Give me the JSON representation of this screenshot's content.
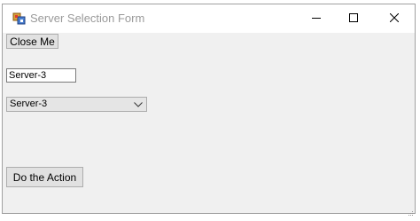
{
  "window": {
    "title": "Server Selection Form",
    "title_color": "#9a9a9a",
    "controls": [
      "minimize-icon",
      "maximize-icon",
      "close-icon"
    ]
  },
  "form": {
    "close_button_label": "Close Me",
    "server_textbox_value": "Server-3",
    "server_combo_selected": "Server-3",
    "action_button_label": "Do the Action"
  }
}
